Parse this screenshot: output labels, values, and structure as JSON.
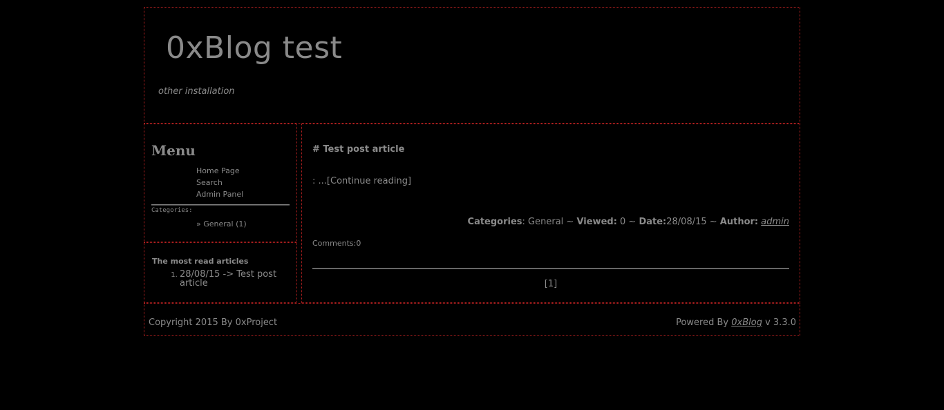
{
  "header": {
    "title": "0xBlog test",
    "subtitle": "other installation"
  },
  "sidebar": {
    "menu_heading": "Menu",
    "menu_items": [
      {
        "label": "Home Page"
      },
      {
        "label": "Search"
      },
      {
        "label": "Admin Panel"
      }
    ],
    "categories_label": "Categories:",
    "categories": [
      {
        "label": "» General (1)"
      }
    ],
    "popular_heading": "The most read articles",
    "popular_articles": [
      {
        "label": "28/08/15 -> Test post article"
      }
    ]
  },
  "post": {
    "title": "# Test post article",
    "excerpt_prefix": ": ...",
    "continue_label": "[Continue reading]",
    "meta": {
      "categories_label": "Categories",
      "categories_value": ": General ~ ",
      "viewed_label": "Viewed:",
      "viewed_value": " 0 ~ ",
      "date_label": "Date:",
      "date_value": "28/08/15 ~ ",
      "author_label": "Author:",
      "author_value": "admin"
    },
    "comments": "Comments:0"
  },
  "pagination": {
    "current_page": "[1]"
  },
  "footer": {
    "copyright": "Copyright 2015 By 0xProject",
    "powered_prefix": "Powered By ",
    "powered_link": "0xBlog",
    "powered_suffix": " v 3.3.0"
  },
  "colors": {
    "background": "#000000",
    "text": "#8a8a8a",
    "border": "#b52020"
  }
}
